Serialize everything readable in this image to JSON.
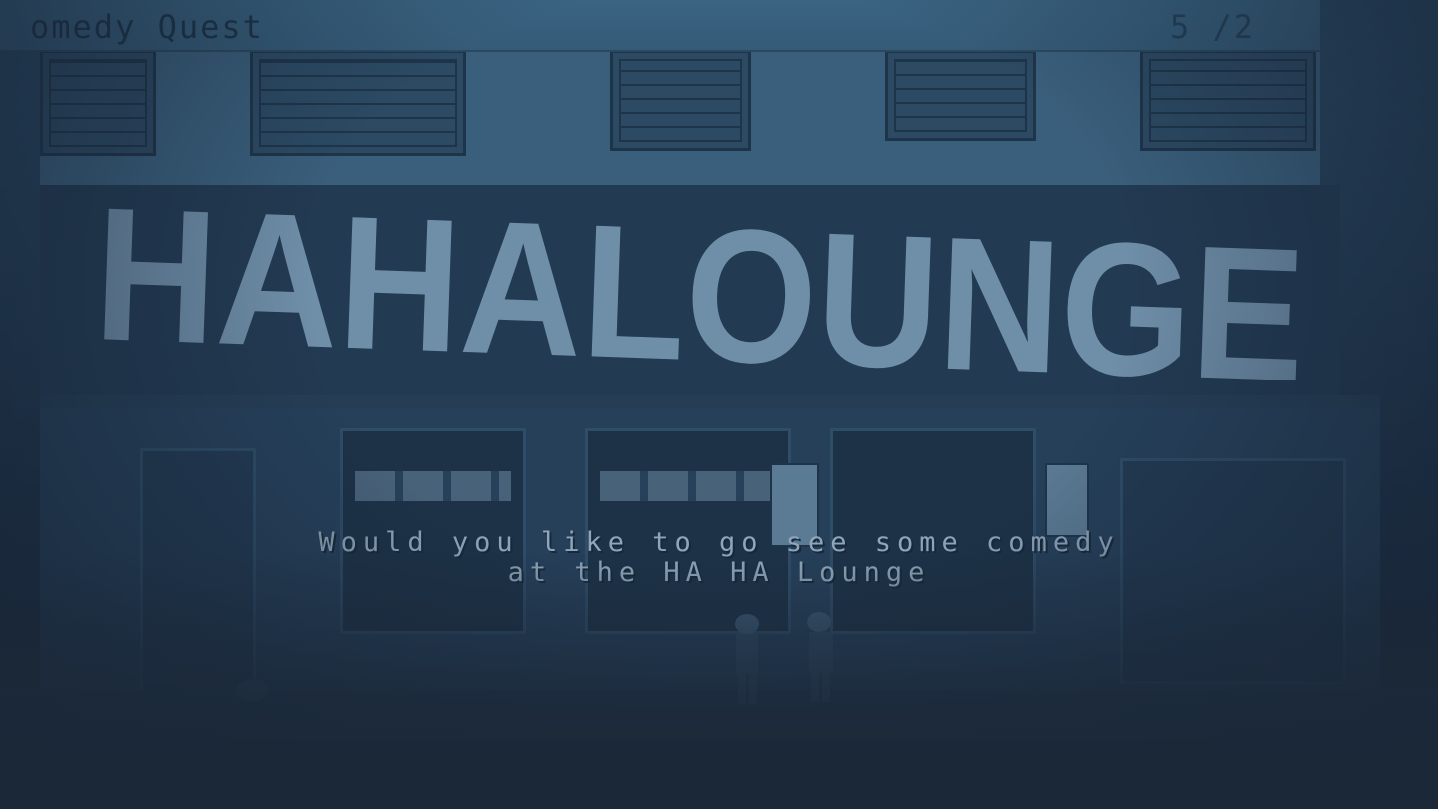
{
  "game": {
    "title": "omedy Quest",
    "score": "5 /2",
    "sign_text": "HAHALOUNGE",
    "dialog_line1": "Would you like to go see some comedy",
    "dialog_line2": "at the HA HA Lounge"
  },
  "colors": {
    "background": "#1b2838",
    "top_bar": "#3a6482",
    "sign_letters": "#6f8ea8",
    "dialog_text": "#8fa6ba"
  }
}
